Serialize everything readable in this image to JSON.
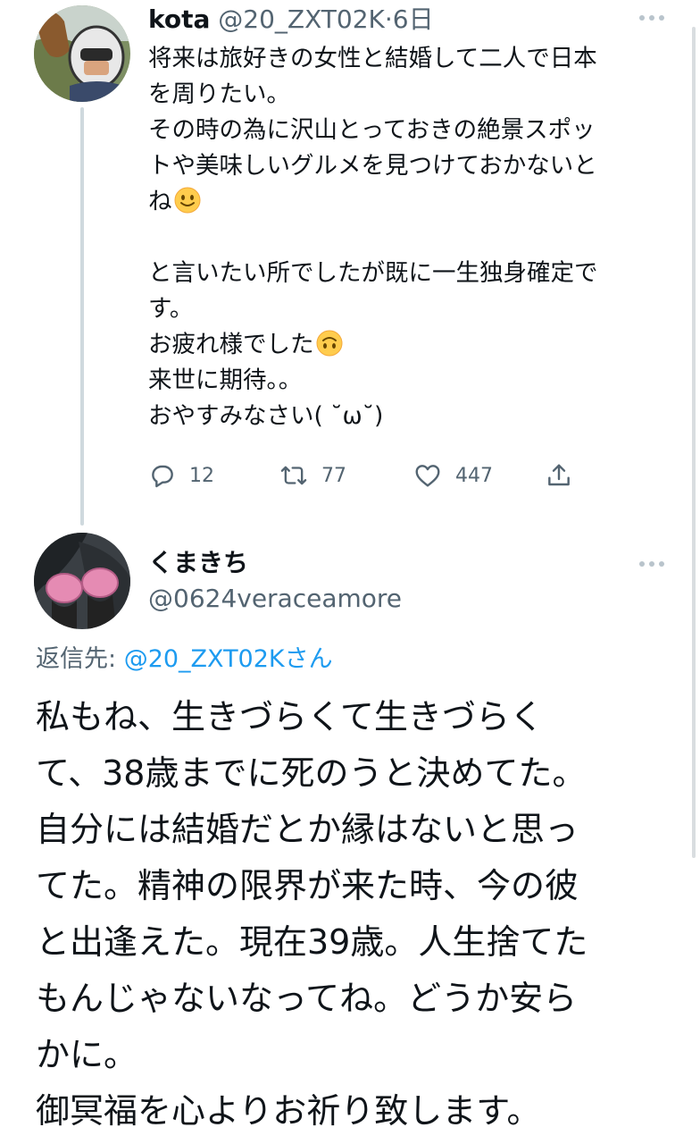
{
  "tweet1": {
    "display_name": "kota",
    "handle": "@20_ZXT02K",
    "separator": "·",
    "time": "6日",
    "lines": [
      "将来は旅好きの女性と結婚して二人で日本",
      "を周りたい。",
      "その時の為に沢山とっておきの絶景スポッ",
      "トや美味しいグルメを見つけておかないと",
      "ね",
      "",
      "と言いたい所でしたが既に一生独身確定で",
      "す。",
      "お疲れ様でした",
      "来世に期待。。",
      "おやすみなさい( ˘ω˘)"
    ],
    "emoji_smile": "smiling-face-emoji",
    "emoji_upside_down": "upside-down-face-emoji",
    "reply_count": "12",
    "retweet_count": "77",
    "like_count": "447",
    "icons": {
      "reply": "comment-bubble-icon",
      "retweet": "retweet-arrows-icon",
      "like": "heart-icon",
      "share": "share-upload-icon",
      "more": "more-dots-icon"
    }
  },
  "tweet2": {
    "display_name": "くまきち",
    "handle": "@0624veraceamore",
    "reply_prefix": "返信先: ",
    "reply_target": "@20_ZXT02Kさん",
    "lines": [
      "私もね、生きづらくて生きづらく",
      "て、38歳までに死のうと決めてた。",
      "自分には結婚だとか縁はないと思っ",
      "てた。精神の限界が来た時、今の彼",
      "と出逢えた。現在39歳。人生捨てた",
      "もんじゃないなってね。どうか安ら",
      "かに。",
      "御冥福を心よりお祈り致します。"
    ]
  },
  "colors": {
    "text": "#0f1419",
    "muted": "#536471",
    "link": "#1d9bf0",
    "thread_line": "#cfd9de"
  }
}
